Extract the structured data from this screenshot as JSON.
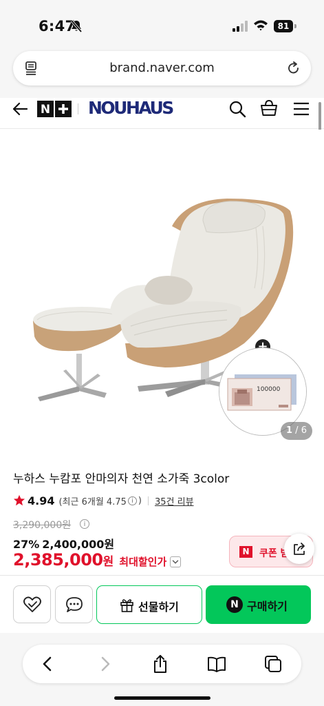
{
  "status_bar": {
    "time": "6:47",
    "battery": "81"
  },
  "browser": {
    "url": "brand.naver.com"
  },
  "header": {
    "nplus_label": "N+",
    "brand_name": "NOUHAUS"
  },
  "gallery": {
    "current_page": "1",
    "page_separator": " / ",
    "total_pages": "6"
  },
  "product": {
    "title": "누하스 누캄포 안마의자 천연 소가죽 3color",
    "rating": "4.94",
    "recent_rating_prefix": "(최근 6개월 4.75",
    "recent_rating_suffix": ")",
    "review_count": "35건 리뷰",
    "original_price": "3,290,000원",
    "discount_rate": "27%",
    "discount_price": "2,400,000원",
    "final_price": "2,385,000",
    "final_price_unit": "원",
    "max_discount_label": "최대할인가",
    "coupon_label": "쿠폰 받기",
    "voucher_amount": "100000"
  },
  "actions": {
    "gift_label": "선물하기",
    "buy_label": "구매하기",
    "buy_badge": "N"
  },
  "colors": {
    "naver_green": "#03c75a",
    "sale_red": "#e0112b",
    "brand_navy": "#1e2a78"
  }
}
